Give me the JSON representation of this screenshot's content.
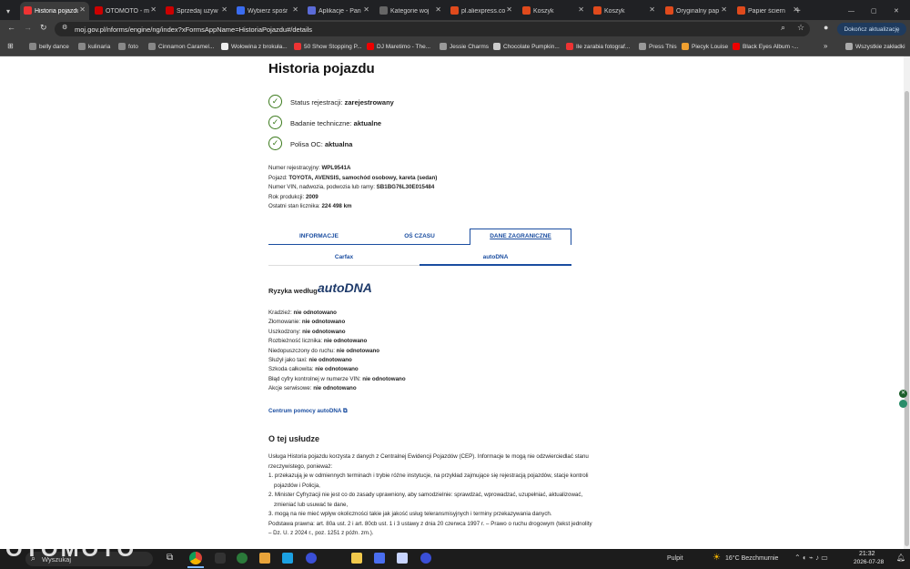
{
  "browser": {
    "tabs": [
      {
        "title": "Historia pojazdu",
        "color": "#e33",
        "active": true
      },
      {
        "title": "OTOMOTO - m",
        "color": "#c00"
      },
      {
        "title": "Sprzedaj używ",
        "color": "#c00"
      },
      {
        "title": "Wybierz spośr",
        "color": "#3a6cf0"
      },
      {
        "title": "Aplikacje - Pan",
        "color": "#5b6bd8"
      },
      {
        "title": "Kategorie woj",
        "color": "#666"
      },
      {
        "title": "pl.aliexpress.co",
        "color": "#e04a1c"
      },
      {
        "title": "Koszyk",
        "color": "#e04a1c"
      },
      {
        "title": "Koszyk",
        "color": "#e04a1c"
      },
      {
        "title": "Oryginalny pap",
        "color": "#e04a1c"
      },
      {
        "title": "Papier ściern",
        "color": "#e04a1c"
      }
    ],
    "url": "moj.gov.pl/nforms/engine/ng/index?xFormsAppName=HistoriaPojazdu#/details",
    "update_button": "Dokończ aktualizację",
    "bookmarks": [
      {
        "label": "belly dance",
        "color": "#888"
      },
      {
        "label": "kulinaria",
        "color": "#888"
      },
      {
        "label": "foto",
        "color": "#888"
      },
      {
        "label": "Cinnamon Caramel...",
        "color": "#888"
      },
      {
        "label": "Wołowina z brokuła...",
        "color": "#eee"
      },
      {
        "label": "50 Show Stopping P...",
        "color": "#e33"
      },
      {
        "label": "DJ Maretimo - The...",
        "color": "#e00"
      },
      {
        "label": "Jessie Charms",
        "color": "#999"
      },
      {
        "label": "Chocolate Pumpkin...",
        "color": "#ccc"
      },
      {
        "label": "Ile zarabia fotograf...",
        "color": "#e33"
      },
      {
        "label": "Press This",
        "color": "#999"
      },
      {
        "label": "Piecyk Louise",
        "color": "#f0a030"
      },
      {
        "label": "Black Eyes Album -...",
        "color": "#e00"
      }
    ],
    "all_bookmarks": "Wszystkie zakładki"
  },
  "page": {
    "title": "Historia pojazdu",
    "status": [
      {
        "label": "Status rejestracji:",
        "value": "zarejestrowany"
      },
      {
        "label": "Badanie techniczne:",
        "value": "aktualne"
      },
      {
        "label": "Polisa OC:",
        "value": "aktualna"
      }
    ],
    "details": [
      {
        "label": "Numer rejestracyjny:",
        "value": "WPL9541A"
      },
      {
        "label": "Pojazd:",
        "value": "TOYOTA, AVENSIS, samochód osobowy, kareta (sedan)"
      },
      {
        "label": "Numer VIN, nadwozia, podwozia lub ramy:",
        "value": "SB1BG76L30E015484"
      },
      {
        "label": "Rok produkcji:",
        "value": "2009"
      },
      {
        "label": "Ostatni stan licznika:",
        "value": "224 498 km"
      }
    ],
    "tabs": [
      "INFORMACJE",
      "OŚ CZASU",
      "DANE ZAGRANICZNE"
    ],
    "subtabs": [
      "Carfax",
      "autoDNA"
    ],
    "risk_heading": "Ryzyka według",
    "risk_logo": "autoDNA",
    "risks": [
      {
        "label": "Kradzież:",
        "value": "nie odnotowano"
      },
      {
        "label": "Złomowanie:",
        "value": "nie odnotowano"
      },
      {
        "label": "Uszkodzony:",
        "value": "nie odnotowano"
      },
      {
        "label": "Rozbieżność licznika:",
        "value": "nie odnotowano"
      },
      {
        "label": "Niedopuszczony do ruchu:",
        "value": "nie odnotowano"
      },
      {
        "label": "Służył jako taxi:",
        "value": "nie odnotowano"
      },
      {
        "label": "Szkoda całkowita:",
        "value": "nie odnotowano"
      },
      {
        "label": "Błąd cyfry kontrolnej w numerze VIN:",
        "value": "nie odnotowano"
      },
      {
        "label": "Akcje serwisowe:",
        "value": "nie odnotowano"
      }
    ],
    "help_link": "Centrum pomocy autoDNA",
    "about_heading": "O tej usłudze",
    "about_lines": [
      "Usługa Historia pojazdu korzysta z danych z Centralnej Ewidencji Pojazdów (CEP). Informacje te mogą nie odzwierciedlać stanu",
      "rzeczywistego, ponieważ:",
      "1. przekazują je w odmiennych terminach i trybie różne instytucje, na przykład zajmujące się rejestracją pojazdów, stacje kontroli",
      "pojazdów i Policja,",
      "2. Minister Cyfryzacji nie jest co do zasady uprawniony, aby samodzielnie: sprawdzać, wprowadzać, uzupełniać, aktualizować,",
      "zmieniać lub usuwać te dane,",
      "3. mogą na nie mieć wpływ okoliczności takie jak jakość usług teleransmisyjnych i terminy przekazywania danych.",
      "Podstawa prawna: art. 80a ust. 2 i art. 80cb ust. 1 i 3 ustawy z dnia 20 czerwca 1997 r. – Prawo o ruchu drogowym (tekst jednolity",
      "– Dz. U. z 2024 r., poz. 1251 z późn. zm.)."
    ]
  },
  "taskbar": {
    "search": "Wyszukaj",
    "watermark": "OTOMOTO",
    "news": "Pulpit",
    "weather": "16°C  Bezchmurnie",
    "time": "21:32",
    "date": "2026-07-28"
  }
}
